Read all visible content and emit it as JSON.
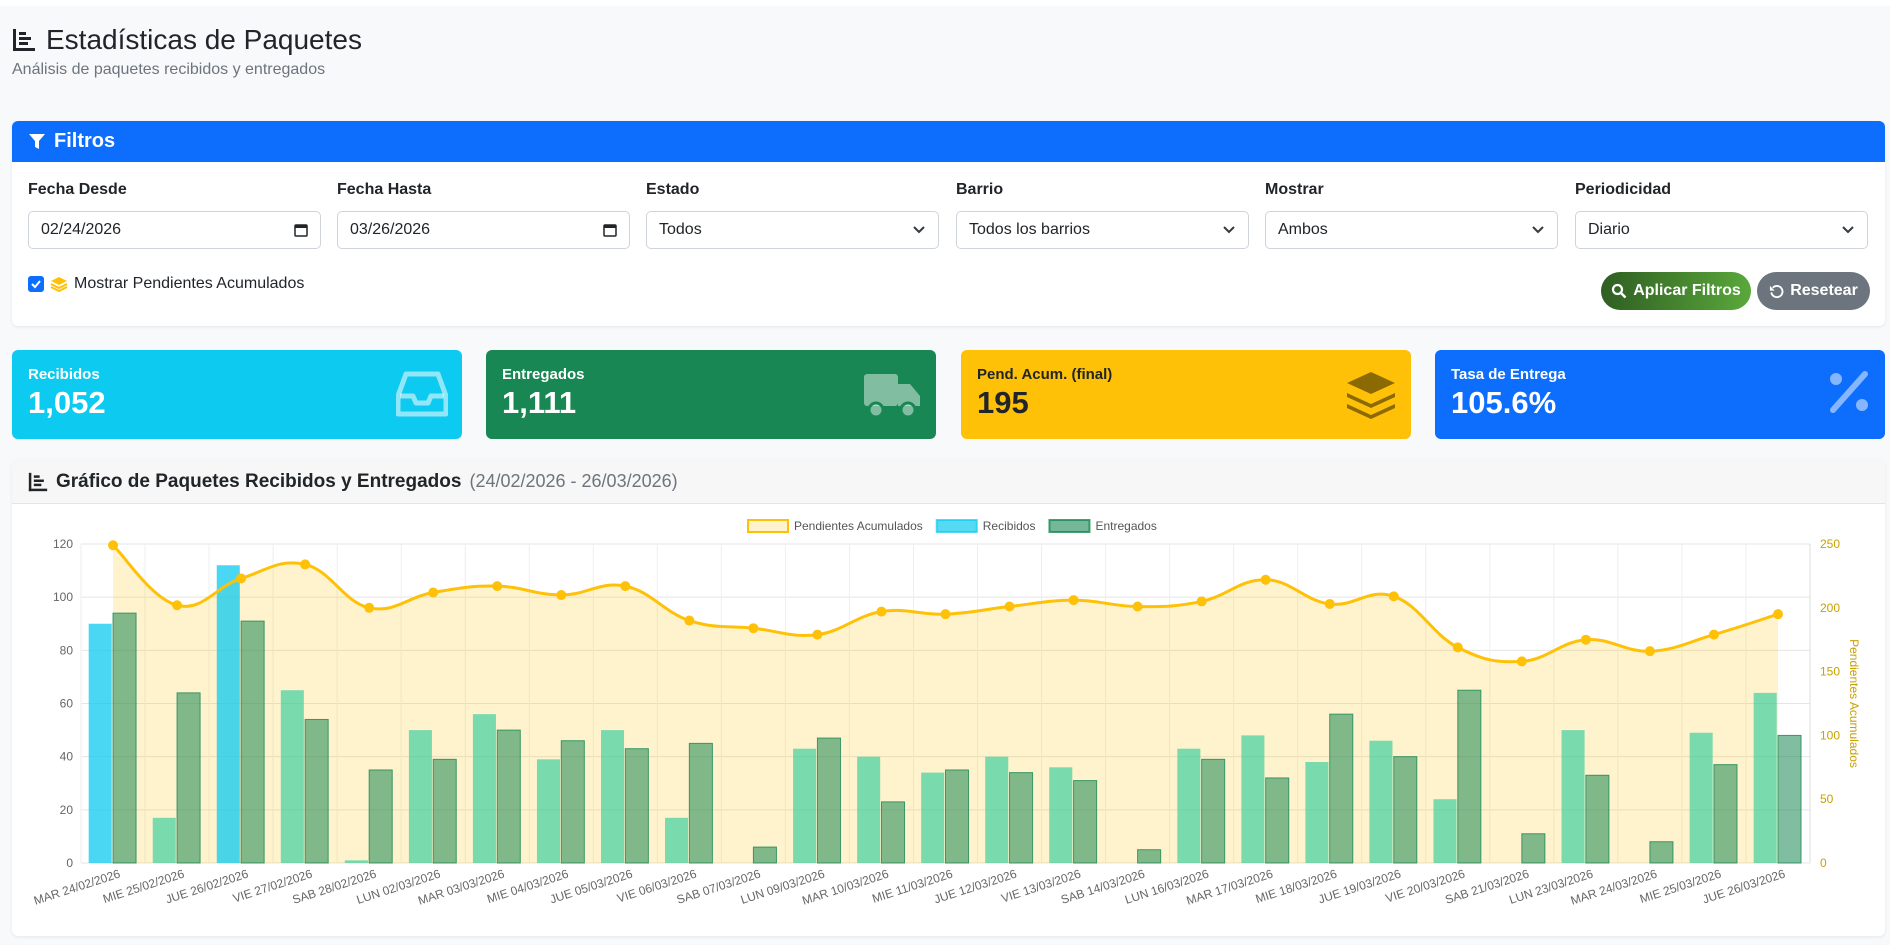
{
  "header": {
    "title": "Estadísticas de Paquetes",
    "subtitle": "Análisis de paquetes recibidos y entregados"
  },
  "filters": {
    "title": "Filtros",
    "fecha_desde": {
      "label": "Fecha Desde",
      "value": "02/24/2026"
    },
    "fecha_hasta": {
      "label": "Fecha Hasta",
      "value": "03/26/2026"
    },
    "estado": {
      "label": "Estado",
      "value": "Todos"
    },
    "barrio": {
      "label": "Barrio",
      "value": "Todos los barrios"
    },
    "mostrar": {
      "label": "Mostrar",
      "value": "Ambos"
    },
    "periodicidad": {
      "label": "Periodicidad",
      "value": "Diario"
    },
    "pendientes_checkbox": {
      "label": "Mostrar Pendientes Acumulados",
      "checked": true
    },
    "apply_label": "Aplicar Filtros",
    "reset_label": "Resetear"
  },
  "stats": {
    "recibidos": {
      "label": "Recibidos",
      "value": "1,052",
      "color": "#0dcaf0"
    },
    "entregados": {
      "label": "Entregados",
      "value": "1,111",
      "color": "#198754"
    },
    "pendientes": {
      "label": "Pend. Acum. (final)",
      "value": "195",
      "color": "#ffc107"
    },
    "tasa": {
      "label": "Tasa de Entrega",
      "value": "105.6%",
      "color": "#0d6efd"
    }
  },
  "chart": {
    "title": "Gráfico de Paquetes Recibidos y Entregados",
    "range": "(24/02/2026 - 26/03/2026)"
  },
  "chart_data": {
    "type": "bar",
    "categories": [
      "MAR 24/02/2026",
      "MIE 25/02/2026",
      "JUE 26/02/2026",
      "VIE 27/02/2026",
      "SAB 28/02/2026",
      "LUN 02/03/2026",
      "MAR 03/03/2026",
      "MIE 04/03/2026",
      "JUE 05/03/2026",
      "VIE 06/03/2026",
      "SAB 07/03/2026",
      "LUN 09/03/2026",
      "MAR 10/03/2026",
      "MIE 11/03/2026",
      "JUE 12/03/2026",
      "VIE 13/03/2026",
      "SAB 14/03/2026",
      "LUN 16/03/2026",
      "MAR 17/03/2026",
      "MIE 18/03/2026",
      "JUE 19/03/2026",
      "VIE 20/03/2026",
      "SAB 21/03/2026",
      "LUN 23/03/2026",
      "MAR 24/03/2026",
      "MIE 25/03/2026",
      "JUE 26/03/2026"
    ],
    "series": [
      {
        "name": "Recibidos",
        "axis": "left",
        "values": [
          90,
          17,
          112,
          65,
          1,
          50,
          56,
          39,
          50,
          17,
          0,
          43,
          40,
          34,
          40,
          36,
          0,
          43,
          48,
          38,
          46,
          24,
          0,
          50,
          0,
          49,
          64
        ]
      },
      {
        "name": "Entregados",
        "axis": "left",
        "values": [
          94,
          64,
          91,
          54,
          35,
          39,
          50,
          46,
          43,
          45,
          6,
          47,
          23,
          35,
          34,
          31,
          5,
          39,
          32,
          56,
          40,
          65,
          11,
          33,
          8,
          37,
          48
        ]
      },
      {
        "name": "Pendientes Acumulados",
        "axis": "right",
        "type": "line",
        "values": [
          249,
          202,
          223,
          234,
          200,
          212,
          217,
          210,
          217,
          190,
          184,
          179,
          197,
          195,
          201,
          206,
          201,
          205,
          222,
          203,
          209,
          169,
          158,
          175,
          166,
          179,
          195
        ]
      }
    ],
    "ylim": [
      0,
      120
    ],
    "y2lim": [
      0,
      250
    ],
    "yticks": [
      "0",
      "20",
      "40",
      "60",
      "80",
      "100",
      "120"
    ],
    "y2ticks": [
      "0",
      "50",
      "100",
      "150",
      "200",
      "250"
    ],
    "y2label": "Pendientes Acumulados",
    "legend": "top",
    "grid": true
  }
}
